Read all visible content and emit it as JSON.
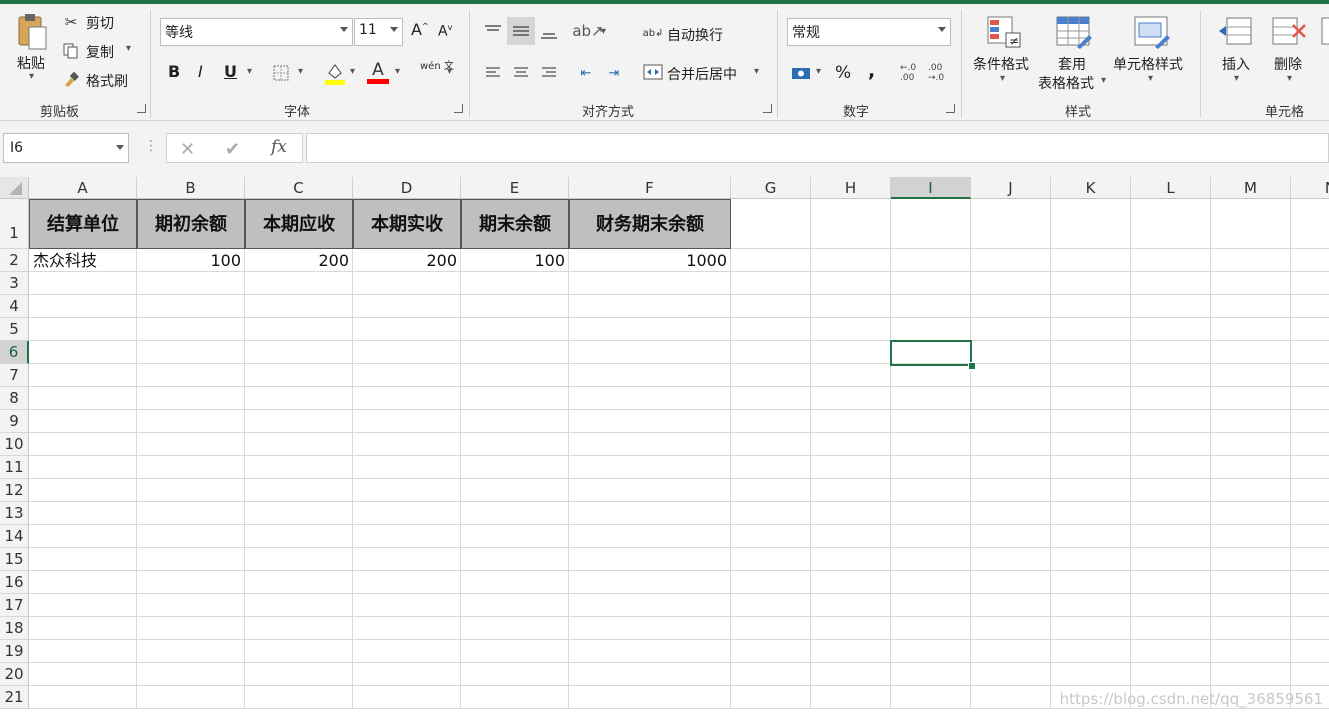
{
  "ribbon": {
    "clipboard": {
      "paste": "粘贴",
      "cut": "剪切",
      "copy": "复制",
      "format_painter": "格式刷",
      "group": "剪贴板"
    },
    "font": {
      "name": "等线",
      "size": "11",
      "group": "字体",
      "bold": "B",
      "italic": "I",
      "underline": "U",
      "font_color_glyph": "A",
      "phonetic_glyph": "wén 文",
      "grow": "A",
      "shrink": "A"
    },
    "alignment": {
      "wrap": "自动换行",
      "merge": "合并后居中",
      "group": "对齐方式"
    },
    "number": {
      "format": "常规",
      "percent": "%",
      "comma": ",",
      "inc_decimal": ".00",
      "dec_decimal": ".00",
      "inc_decimal_b": "←.0",
      "dec_decimal_b": "→.0",
      "group": "数字"
    },
    "styles": {
      "conditional": "条件格式",
      "table_line1": "套用",
      "table_line2": "表格格式",
      "cell_styles": "单元格样式",
      "group": "样式"
    },
    "cells": {
      "insert": "插入",
      "delete": "删除",
      "group": "单元格"
    }
  },
  "formula_bar": {
    "name_box": "I6",
    "cancel": "✕",
    "enter": "✔",
    "fx": "fx",
    "content": ""
  },
  "columns": [
    "A",
    "B",
    "C",
    "D",
    "E",
    "F",
    "G",
    "H",
    "I",
    "J",
    "K",
    "L",
    "M",
    "N"
  ],
  "rows": [
    "1",
    "2",
    "3",
    "4",
    "5",
    "6",
    "7",
    "8",
    "9",
    "10",
    "11",
    "12",
    "13",
    "14",
    "15",
    "16",
    "17",
    "18",
    "19",
    "20",
    "21"
  ],
  "table": {
    "headers": [
      "结算单位",
      "期初余额",
      "本期应收",
      "本期实收",
      "期末余额",
      "财务期末余额"
    ],
    "row2": [
      "杰众科技",
      "100",
      "200",
      "200",
      "100",
      "1000"
    ]
  },
  "selected_cell": "I6",
  "watermark": "https://blog.csdn.net/qq_36859561",
  "colors": {
    "accent": "#217346",
    "header_fill": "#bfbfbf",
    "fill_color": "#ffff00",
    "font_color": "#ff0000"
  }
}
